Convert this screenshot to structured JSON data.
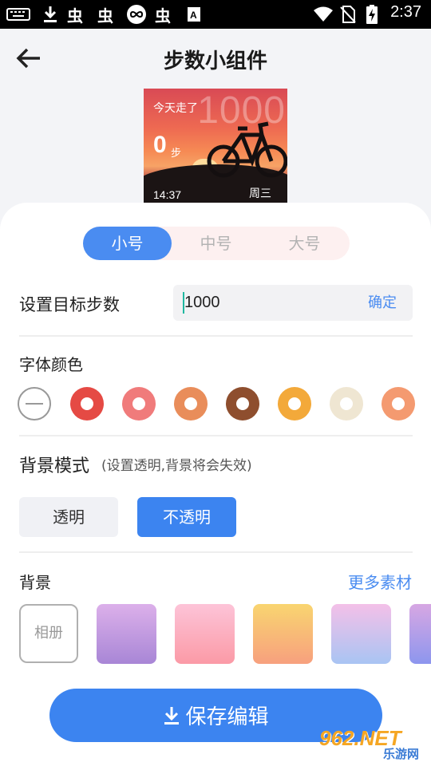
{
  "status_bar": {
    "time": "2:37",
    "icons": [
      "keyboard-icon",
      "download-icon",
      "bug-icon",
      "bug-icon",
      "infinity-icon",
      "bug-icon",
      "font-a-icon",
      "wifi-icon",
      "no-sim-icon",
      "battery-charging-icon"
    ]
  },
  "header": {
    "title": "步数小组件"
  },
  "preview": {
    "label": "今天走了",
    "target": "1000",
    "steps": "0",
    "unit": "步",
    "time": "14:37",
    "weekday": "周三"
  },
  "size_tabs": {
    "items": [
      "小号",
      "中号",
      "大号"
    ],
    "selected": "小号"
  },
  "target": {
    "label": "设置目标步数",
    "value": "1000",
    "confirm": "确定"
  },
  "font_color": {
    "label": "字体颜色",
    "swatches": [
      "none",
      "#e54a44",
      "#f07b7b",
      "#e98d5a",
      "#8e4e2e",
      "#f3a93a",
      "#efe6d2",
      "#f49a70"
    ]
  },
  "bg_mode": {
    "title": "背景模式",
    "hint": "(设置透明,背景将会失效)",
    "options": [
      "透明",
      "不透明"
    ],
    "selected": "不透明"
  },
  "background": {
    "label": "背景",
    "more": "更多素材",
    "album": "相册"
  },
  "save": {
    "label": "保存编辑"
  },
  "watermark": {
    "top": "962.NET",
    "bottom": "乐游网"
  }
}
